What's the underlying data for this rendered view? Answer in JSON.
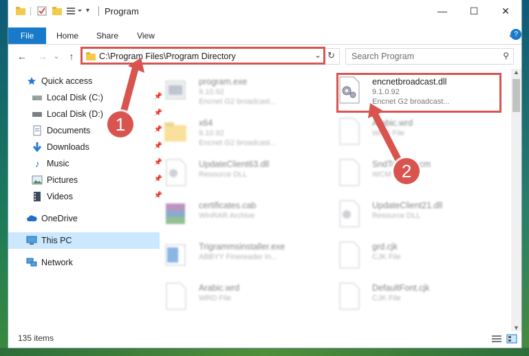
{
  "window": {
    "title": "Program",
    "controls": {
      "minimize": "—",
      "maximize": "☐",
      "close": "✕"
    }
  },
  "ribbon": {
    "tabs": [
      "File",
      "Home",
      "Share",
      "View"
    ]
  },
  "address": {
    "path": "C:\\Program Files\\Program Directory",
    "search_placeholder": "Search Program"
  },
  "nav": {
    "items": [
      {
        "label": "Quick access",
        "icon": "star-icon"
      },
      {
        "label": "Local Disk (C:)",
        "icon": "drive-icon",
        "pinned": true
      },
      {
        "label": "Local Disk (D:)",
        "icon": "drive-icon",
        "pinned": true
      },
      {
        "label": "Documents",
        "icon": "documents-icon",
        "pinned": true
      },
      {
        "label": "Downloads",
        "icon": "downloads-icon",
        "pinned": true
      },
      {
        "label": "Music",
        "icon": "music-icon",
        "pinned": true
      },
      {
        "label": "Pictures",
        "icon": "pictures-icon",
        "pinned": true
      },
      {
        "label": "Videos",
        "icon": "videos-icon",
        "pinned": true
      },
      {
        "label": "OneDrive",
        "icon": "cloud-icon"
      },
      {
        "label": "This PC",
        "icon": "computer-icon",
        "selected": true
      },
      {
        "label": "Network",
        "icon": "network-icon"
      }
    ]
  },
  "files": [
    {
      "name": "program.exe",
      "line2": "9.10.92",
      "line3": "Encnet G2 broadcast..."
    },
    {
      "name": "encnetbroadcast.dll",
      "line2": "9.1.0.92",
      "line3": "Encnet G2 broadcast..."
    },
    {
      "name": "x64",
      "line2": "9.10.92",
      "line3": "Encnet G2 broadcast..."
    },
    {
      "name": "Arabic.wrd",
      "line2": "WRD File",
      "line3": ""
    },
    {
      "name": "UpdateClient63.dll",
      "line2": "Resource DLL",
      "line3": ""
    },
    {
      "name": "SndToWrd.ecm",
      "line2": "WCM File",
      "line3": ""
    },
    {
      "name": "certificates.cab",
      "line2": "WinRAR Archive",
      "line3": ""
    },
    {
      "name": "UpdateClient21.dll",
      "line2": "Resource DLL",
      "line3": ""
    },
    {
      "name": "Trigrammsinstaller.exe",
      "line2": "ABBYY Finereader In...",
      "line3": ""
    },
    {
      "name": "grd.cjk",
      "line2": "CJK File",
      "line3": ""
    },
    {
      "name": "Arabic.wrd",
      "line2": "WRD File",
      "line3": ""
    },
    {
      "name": "DefaultFont.cjk",
      "line2": "CJK File",
      "line3": ""
    }
  ],
  "status": {
    "count": "135 items"
  },
  "annotations": {
    "step1": "1",
    "step2": "2"
  },
  "colors": {
    "accent": "#1979ca",
    "highlight": "#d9534f",
    "selected": "#cce8ff"
  }
}
